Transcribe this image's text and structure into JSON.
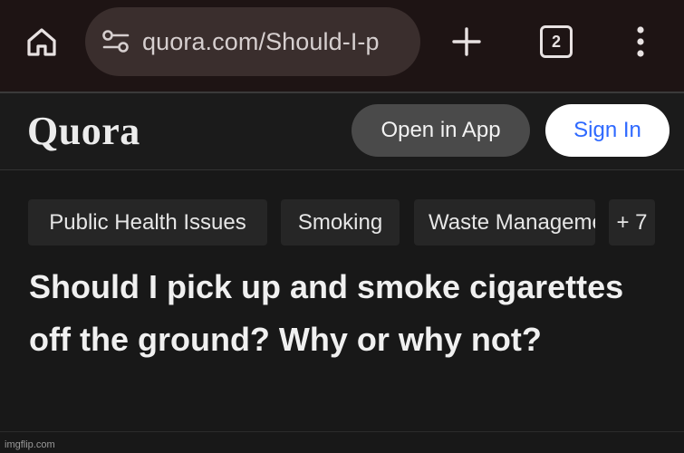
{
  "browser": {
    "url": "quora.com/Should-I-p",
    "tab_count": "2",
    "icons": [
      "home-icon",
      "site-settings-icon",
      "new-tab-icon",
      "tab-switcher-icon",
      "more-menu-icon"
    ]
  },
  "header": {
    "logo": "Quora",
    "open_in_app": "Open in App",
    "sign_in": "Sign In",
    "colors": {
      "sign_in_text": "#2e69ff",
      "open_app_bg": "#4a4a4a"
    }
  },
  "topics": [
    {
      "label": "Public Health Issues"
    },
    {
      "label": "Smoking"
    },
    {
      "label": "Waste Management"
    },
    {
      "label": "+ 7"
    }
  ],
  "question": {
    "title": "Should I pick up and smoke cigarettes off the ground? Why or why not?"
  },
  "watermark": "imgflip.com"
}
